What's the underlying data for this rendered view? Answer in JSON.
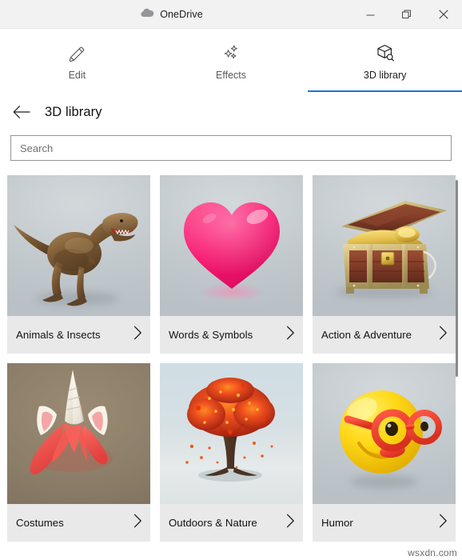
{
  "window": {
    "title": "OneDrive",
    "app_icon": "onedrive-cloud-icon",
    "controls": {
      "minimize_label": "Minimize",
      "restore_label": "Restore Down",
      "close_label": "Close"
    }
  },
  "tabs": [
    {
      "label": "Edit",
      "icon": "pencil-icon",
      "active": false
    },
    {
      "label": "Effects",
      "icon": "sparkles-icon",
      "active": false
    },
    {
      "label": "3D library",
      "icon": "cube-search-icon",
      "active": true
    }
  ],
  "header": {
    "back_icon": "back-arrow-icon",
    "title": "3D library"
  },
  "search": {
    "placeholder": "Search",
    "value": ""
  },
  "colors": {
    "accent": "#1877d2",
    "card_footer": "#e9e9e9",
    "titlebar": "#f2f2f2",
    "scrollbar_thumb": "#8a8a8a"
  },
  "library": {
    "chevron_icon": "chevron-right-icon",
    "categories": [
      {
        "label": "Animals & Insects",
        "thumbnail": "t-rex-dinosaur"
      },
      {
        "label": "Words & Symbols",
        "thumbnail": "pink-heart"
      },
      {
        "label": "Action & Adventure",
        "thumbnail": "treasure-chest"
      },
      {
        "label": "Costumes",
        "thumbnail": "unicorn-horn-headband"
      },
      {
        "label": "Outdoors & Nature",
        "thumbnail": "autumn-tree"
      },
      {
        "label": "Humor",
        "thumbnail": "smiley-with-glasses"
      }
    ]
  },
  "scrollbar": {
    "name": "vertical-scrollbar"
  },
  "watermark": {
    "text": "wsxdn.com"
  }
}
